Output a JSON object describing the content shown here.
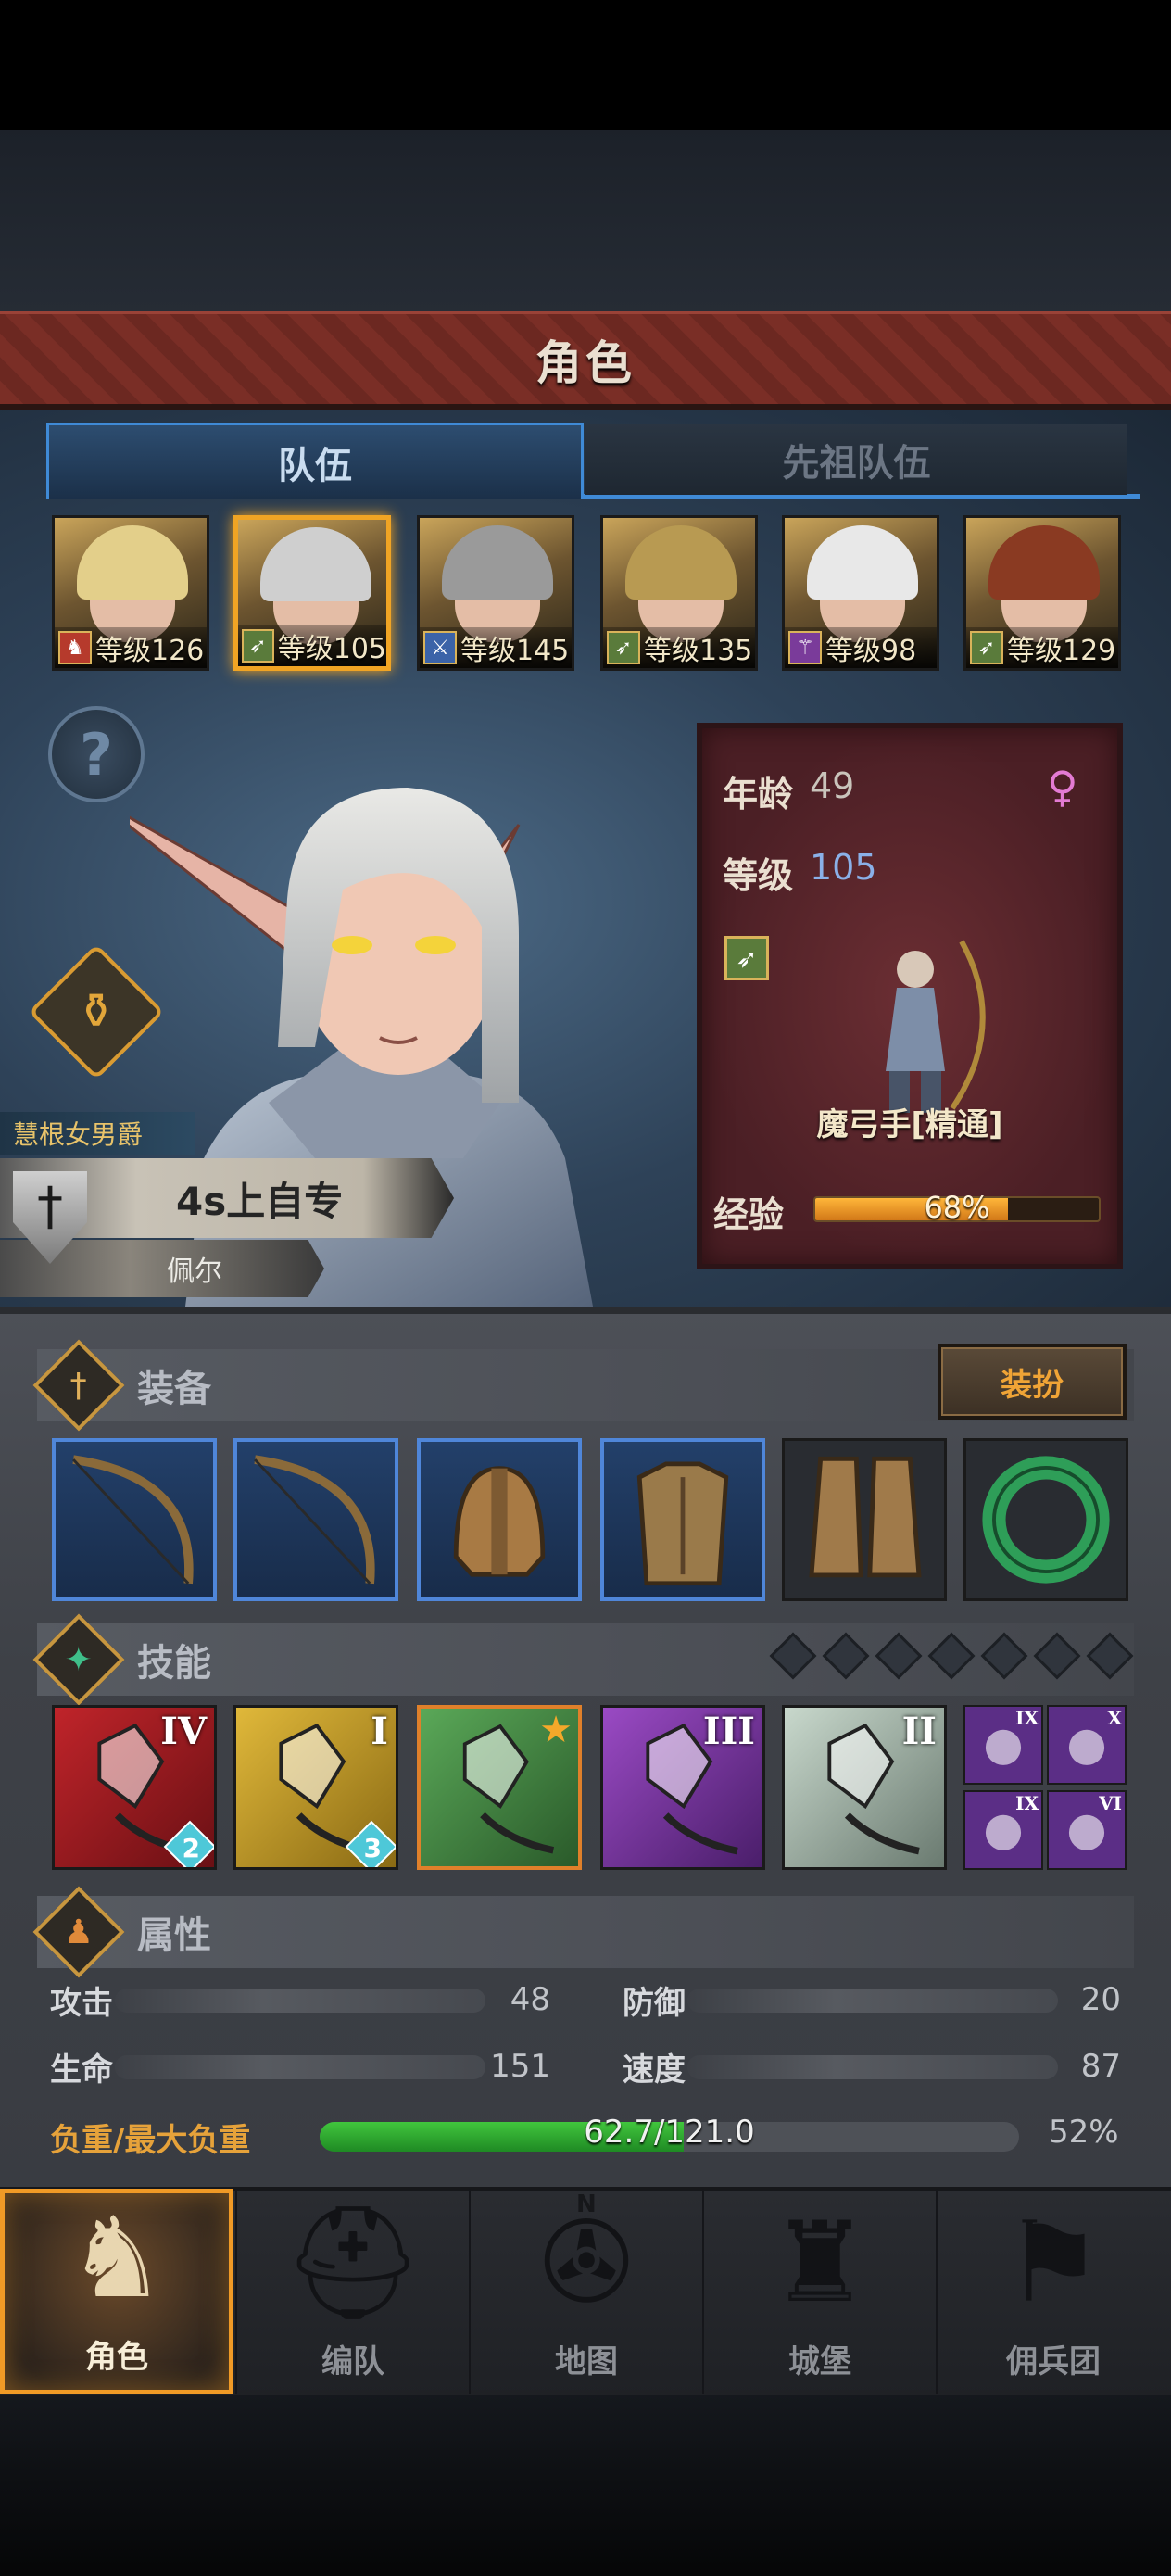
{
  "header": {
    "title": "角色"
  },
  "tabs": [
    {
      "label": "队伍",
      "active": true
    },
    {
      "label": "先祖队伍",
      "active": false
    }
  ],
  "party": [
    {
      "level_text": "等级126",
      "class_icon": "horse-icon",
      "class_color": "#b63a2c",
      "hair": "#e3cf8a",
      "selected": false
    },
    {
      "level_text": "等级105",
      "class_icon": "bow-icon",
      "class_color": "#5a7b3b",
      "hair": "#cfcfcf",
      "selected": true
    },
    {
      "level_text": "等级145",
      "class_icon": "sword-icon",
      "class_color": "#3b63a8",
      "hair": "#9a9a9a",
      "selected": false
    },
    {
      "level_text": "等级135",
      "class_icon": "bow-icon",
      "class_color": "#5a7b3b",
      "hair": "#b89a52",
      "selected": false
    },
    {
      "level_text": "等级98",
      "class_icon": "staff-icon",
      "class_color": "#7a3b9a",
      "hair": "#e8e8e8",
      "selected": false
    },
    {
      "level_text": "等级129",
      "class_icon": "bow-icon",
      "class_color": "#5a7b3b",
      "hair": "#8a3a22",
      "selected": false
    }
  ],
  "character": {
    "age_label": "年龄",
    "age_value": "49",
    "level_label": "等级",
    "level_value": "105",
    "class_name": "魔弓手[精通]",
    "exp_label": "经验",
    "exp_text": "68%",
    "exp_fraction": 0.68,
    "title": "慧根女男爵",
    "name": "4s上自专",
    "subname": "佩尔"
  },
  "equipment": {
    "title": "装备",
    "dress_label": "装扮",
    "slots": [
      "bow-icon",
      "bow-icon",
      "helmet-icon",
      "armor-icon",
      "boots-icon",
      "ring-icon"
    ]
  },
  "skills": {
    "title": "技能",
    "items": [
      {
        "rank": "IV",
        "badge": "2",
        "icon": "sword-strike-icon"
      },
      {
        "rank": "I",
        "badge": "3",
        "icon": "shield-heal-icon"
      },
      {
        "rank": "",
        "badge": "",
        "icon": "crystal-spear-icon"
      },
      {
        "rank": "III",
        "badge": "",
        "icon": "crystal-arm-icon"
      },
      {
        "rank": "II",
        "badge": "",
        "icon": "crystal-arm-icon"
      }
    ],
    "mini": [
      {
        "rank": "IX",
        "icon": "arrow-icon"
      },
      {
        "rank": "X",
        "icon": "burst-icon"
      },
      {
        "rank": "IX",
        "icon": "target-icon"
      },
      {
        "rank": "VI",
        "icon": "splash-icon"
      }
    ]
  },
  "attributes": {
    "title": "属性",
    "attack_label": "攻击",
    "attack_value": "48",
    "defense_label": "防御",
    "defense_value": "20",
    "hp_label": "生命",
    "hp_value": "151",
    "speed_label": "速度",
    "speed_value": "87",
    "load_label": "负重/最大负重",
    "load_text": "62.7/121.0",
    "load_pct": "52%",
    "load_fraction": 0.52
  },
  "nav": [
    {
      "label": "角色",
      "icon": "knight-icon",
      "active": true
    },
    {
      "label": "编队",
      "icon": "helmet-icon",
      "active": false
    },
    {
      "label": "地图",
      "icon": "compass-icon",
      "active": false
    },
    {
      "label": "城堡",
      "icon": "castle-icon",
      "active": false
    },
    {
      "label": "佣兵团",
      "icon": "banner-icon",
      "active": false
    }
  ],
  "compass_letter": "N"
}
